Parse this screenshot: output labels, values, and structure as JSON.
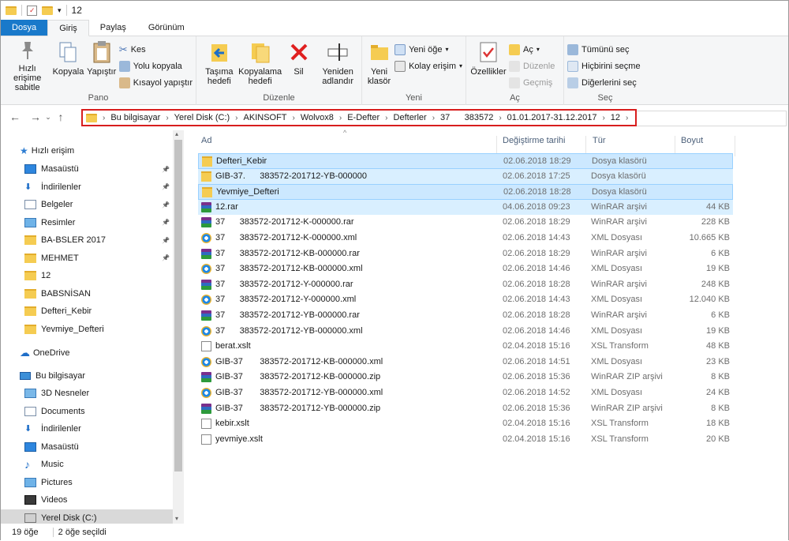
{
  "window": {
    "title": "12"
  },
  "tabs": [
    {
      "label": "Dosya",
      "kind": "file"
    },
    {
      "label": "Giriş",
      "kind": "active"
    },
    {
      "label": "Paylaş",
      "kind": "normal"
    },
    {
      "label": "Görünüm",
      "kind": "normal"
    }
  ],
  "ribbon": {
    "pano": {
      "label": "Pano",
      "pin": "Hızlı erişime sabitle",
      "copy": "Kopyala",
      "paste": "Yapıştır",
      "cut": "Kes",
      "copy_path": "Yolu kopyala",
      "paste_shortcut": "Kısayol yapıştır"
    },
    "duzenle": {
      "label": "Düzenle",
      "move_to": "Taşıma hedefi",
      "copy_to": "Kopyalama hedefi",
      "delete": "Sil",
      "rename": "Yeniden adlandır"
    },
    "yeni": {
      "label": "Yeni",
      "new_folder": "Yeni klasör",
      "new_item": "Yeni öğe",
      "easy_access": "Kolay erişim"
    },
    "ac": {
      "label": "Aç",
      "properties": "Özellikler",
      "open": "Aç",
      "edit": "Düzenle",
      "history": "Geçmiş"
    },
    "sec": {
      "label": "Seç",
      "select_all": "Tümünü seç",
      "select_none": "Hiçbirini seçme",
      "invert": "Diğerlerini seç"
    }
  },
  "address": {
    "crumbs": [
      "Bu bilgisayar",
      "Yerel Disk (C:)",
      "AKINSOFT",
      "Wolvox8",
      "E-Defter",
      "Defterler",
      "37   ",
      "   383572",
      "01.01.2017-31.12.2017",
      "12"
    ]
  },
  "nav": {
    "quick_access": "Hızlı erişim",
    "quick_items": [
      {
        "label": "Masaüstü",
        "icon": "desktop-icon",
        "pinned": true
      },
      {
        "label": "İndirilenler",
        "icon": "download-icon",
        "pinned": true
      },
      {
        "label": "Belgeler",
        "icon": "documents-icon",
        "pinned": true
      },
      {
        "label": "Resimler",
        "icon": "pictures-icon",
        "pinned": true
      },
      {
        "label": "BA-BSLER 2017",
        "icon": "folder-icon",
        "pinned": true
      },
      {
        "label": "MEHMET",
        "icon": "folder-icon",
        "pinned": true
      },
      {
        "label": "12",
        "icon": "folder-icon",
        "pinned": false
      },
      {
        "label": "BABSNİSAN",
        "icon": "folder-icon",
        "pinned": false
      },
      {
        "label": "Defteri_Kebir",
        "icon": "folder-icon",
        "pinned": false
      },
      {
        "label": "Yevmiye_Defteri",
        "icon": "folder-icon",
        "pinned": false
      }
    ],
    "onedrive": "OneDrive",
    "this_pc": "Bu bilgisayar",
    "pc_items": [
      {
        "label": "3D Nesneler",
        "icon": "3d-objects-icon"
      },
      {
        "label": "Documents",
        "icon": "documents-icon"
      },
      {
        "label": "İndirilenler",
        "icon": "download-icon"
      },
      {
        "label": "Masaüstü",
        "icon": "desktop-icon"
      },
      {
        "label": "Music",
        "icon": "music-icon"
      },
      {
        "label": "Pictures",
        "icon": "pictures-icon"
      },
      {
        "label": "Videos",
        "icon": "videos-icon"
      },
      {
        "label": "Yerel Disk (C:)",
        "icon": "drive-icon"
      }
    ]
  },
  "columns": {
    "name": "Ad",
    "date": "Değiştirme tarihi",
    "type": "Tür",
    "size": "Boyut"
  },
  "files": [
    {
      "name": "Defteri_Kebir",
      "date": "02.06.2018 18:29",
      "type": "Dosya klasörü",
      "size": "",
      "icon": "folder",
      "selected": true
    },
    {
      "name": "GIB-37.      383572-201712-YB-000000",
      "date": "02.06.2018 17:25",
      "type": "Dosya klasörü",
      "size": "",
      "icon": "folder",
      "selected": false
    },
    {
      "name": "Yevmiye_Defteri",
      "date": "02.06.2018 18:28",
      "type": "Dosya klasörü",
      "size": "",
      "icon": "folder",
      "selected": true
    },
    {
      "name": "12.rar",
      "date": "04.06.2018 09:23",
      "type": "WinRAR arşivi",
      "size": "44 KB",
      "icon": "rar",
      "selected": false
    },
    {
      "name": "37      383572-201712-K-000000.rar",
      "date": "02.06.2018 18:29",
      "type": "WinRAR arşivi",
      "size": "228 KB",
      "icon": "rar",
      "selected": false
    },
    {
      "name": "37      383572-201712-K-000000.xml",
      "date": "02.06.2018 14:43",
      "type": "XML Dosyası",
      "size": "10.665 KB",
      "icon": "xml",
      "selected": false
    },
    {
      "name": "37      383572-201712-KB-000000.rar",
      "date": "02.06.2018 18:29",
      "type": "WinRAR arşivi",
      "size": "6 KB",
      "icon": "rar",
      "selected": false
    },
    {
      "name": "37      383572-201712-KB-000000.xml",
      "date": "02.06.2018 14:46",
      "type": "XML Dosyası",
      "size": "19 KB",
      "icon": "xml",
      "selected": false
    },
    {
      "name": "37      383572-201712-Y-000000.rar",
      "date": "02.06.2018 18:28",
      "type": "WinRAR arşivi",
      "size": "248 KB",
      "icon": "rar",
      "selected": false
    },
    {
      "name": "37      383572-201712-Y-000000.xml",
      "date": "02.06.2018 14:43",
      "type": "XML Dosyası",
      "size": "12.040 KB",
      "icon": "xml",
      "selected": false
    },
    {
      "name": "37      383572-201712-YB-000000.rar",
      "date": "02.06.2018 18:28",
      "type": "WinRAR arşivi",
      "size": "6 KB",
      "icon": "rar",
      "selected": false
    },
    {
      "name": "37      383572-201712-YB-000000.xml",
      "date": "02.06.2018 14:46",
      "type": "XML Dosyası",
      "size": "19 KB",
      "icon": "xml",
      "selected": false
    },
    {
      "name": "berat.xslt",
      "date": "02.04.2018 15:16",
      "type": "XSL Transform",
      "size": "48 KB",
      "icon": "doc",
      "selected": false
    },
    {
      "name": "GIB-37       383572-201712-KB-000000.xml",
      "date": "02.06.2018 14:51",
      "type": "XML Dosyası",
      "size": "23 KB",
      "icon": "xml",
      "selected": false
    },
    {
      "name": "GIB-37       383572-201712-KB-000000.zip",
      "date": "02.06.2018 15:36",
      "type": "WinRAR ZIP arşivi",
      "size": "8 KB",
      "icon": "rar",
      "selected": false
    },
    {
      "name": "GIB-37       383572-201712-YB-000000.xml",
      "date": "02.06.2018 14:52",
      "type": "XML Dosyası",
      "size": "24 KB",
      "icon": "xml",
      "selected": false
    },
    {
      "name": "GIB-37       383572-201712-YB-000000.zip",
      "date": "02.06.2018 15:36",
      "type": "WinRAR ZIP arşivi",
      "size": "8 KB",
      "icon": "rar",
      "selected": false
    },
    {
      "name": "kebir.xslt",
      "date": "02.04.2018 15:16",
      "type": "XSL Transform",
      "size": "18 KB",
      "icon": "doc",
      "selected": false
    },
    {
      "name": "yevmiye.xslt",
      "date": "02.04.2018 15:16",
      "type": "XSL Transform",
      "size": "20 KB",
      "icon": "doc",
      "selected": false
    }
  ],
  "status": {
    "count": "19 öğe",
    "selected": "2 öğe seçildi"
  },
  "colors": {
    "accent": "#1979ca",
    "selection": "#cce8ff",
    "highlight_border": "#d81e1e"
  }
}
